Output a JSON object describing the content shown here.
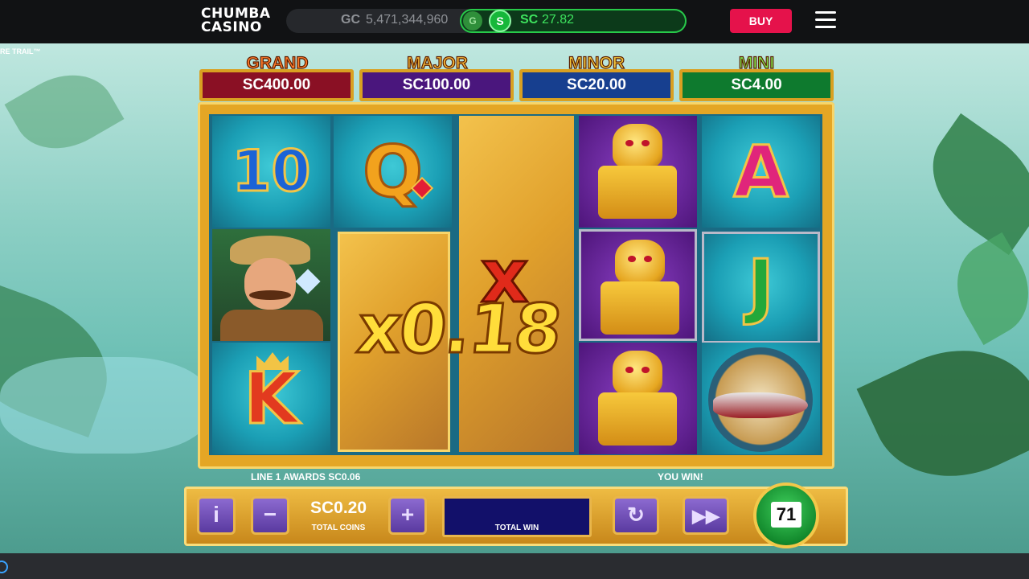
{
  "header": {
    "logo_line1": "CHUMBA",
    "logo_line2": "CASINO",
    "gc_label": "GC",
    "gc_balance": "5,471,344,960",
    "gc_coin_icon": "G",
    "sc_coin_icon": "S",
    "sc_label": "SC",
    "sc_balance": "27.82",
    "buy_label": "BUY",
    "menu_icon": "hamburger-menu-icon"
  },
  "game": {
    "trail_text": "RE TRAIL™",
    "jackpots": [
      {
        "name": "GRAND",
        "value": "SC400.00",
        "name_color": "#ff7a2a",
        "box_color": "#8a1024"
      },
      {
        "name": "MAJOR",
        "value": "SC100.00",
        "name_color": "#f3b637",
        "box_color": "#4a167d"
      },
      {
        "name": "MINOR",
        "value": "SC20.00",
        "name_color": "#f3c93c",
        "box_color": "#173f8f"
      },
      {
        "name": "MINI",
        "value": "SC4.00",
        "name_color": "#7ee04a",
        "box_color": "#0e7a2e"
      }
    ],
    "reels": [
      [
        "10",
        "explorer",
        "K"
      ],
      [
        "Q",
        "map",
        "map"
      ],
      [
        "map",
        "map",
        "map"
      ],
      [
        "idol",
        "idol",
        "idol"
      ],
      [
        "A",
        "J",
        "compass-plane"
      ]
    ],
    "multiplier_x": "x",
    "multiplier_text": "x0.18",
    "line_award_text": "LINE 1 AWARDS SC0.06",
    "win_text": "YOU WIN!"
  },
  "controls": {
    "info_label": "i",
    "minus_label": "−",
    "plus_label": "+",
    "total_coins_value": "SC0.20",
    "total_coins_label": "TOTAL COINS",
    "total_win_value": "",
    "total_win_label": "TOTAL WIN",
    "autoplay_icon": "refresh-icon",
    "turbo_icon": "fast-forward-icon",
    "spin_count": "71"
  }
}
